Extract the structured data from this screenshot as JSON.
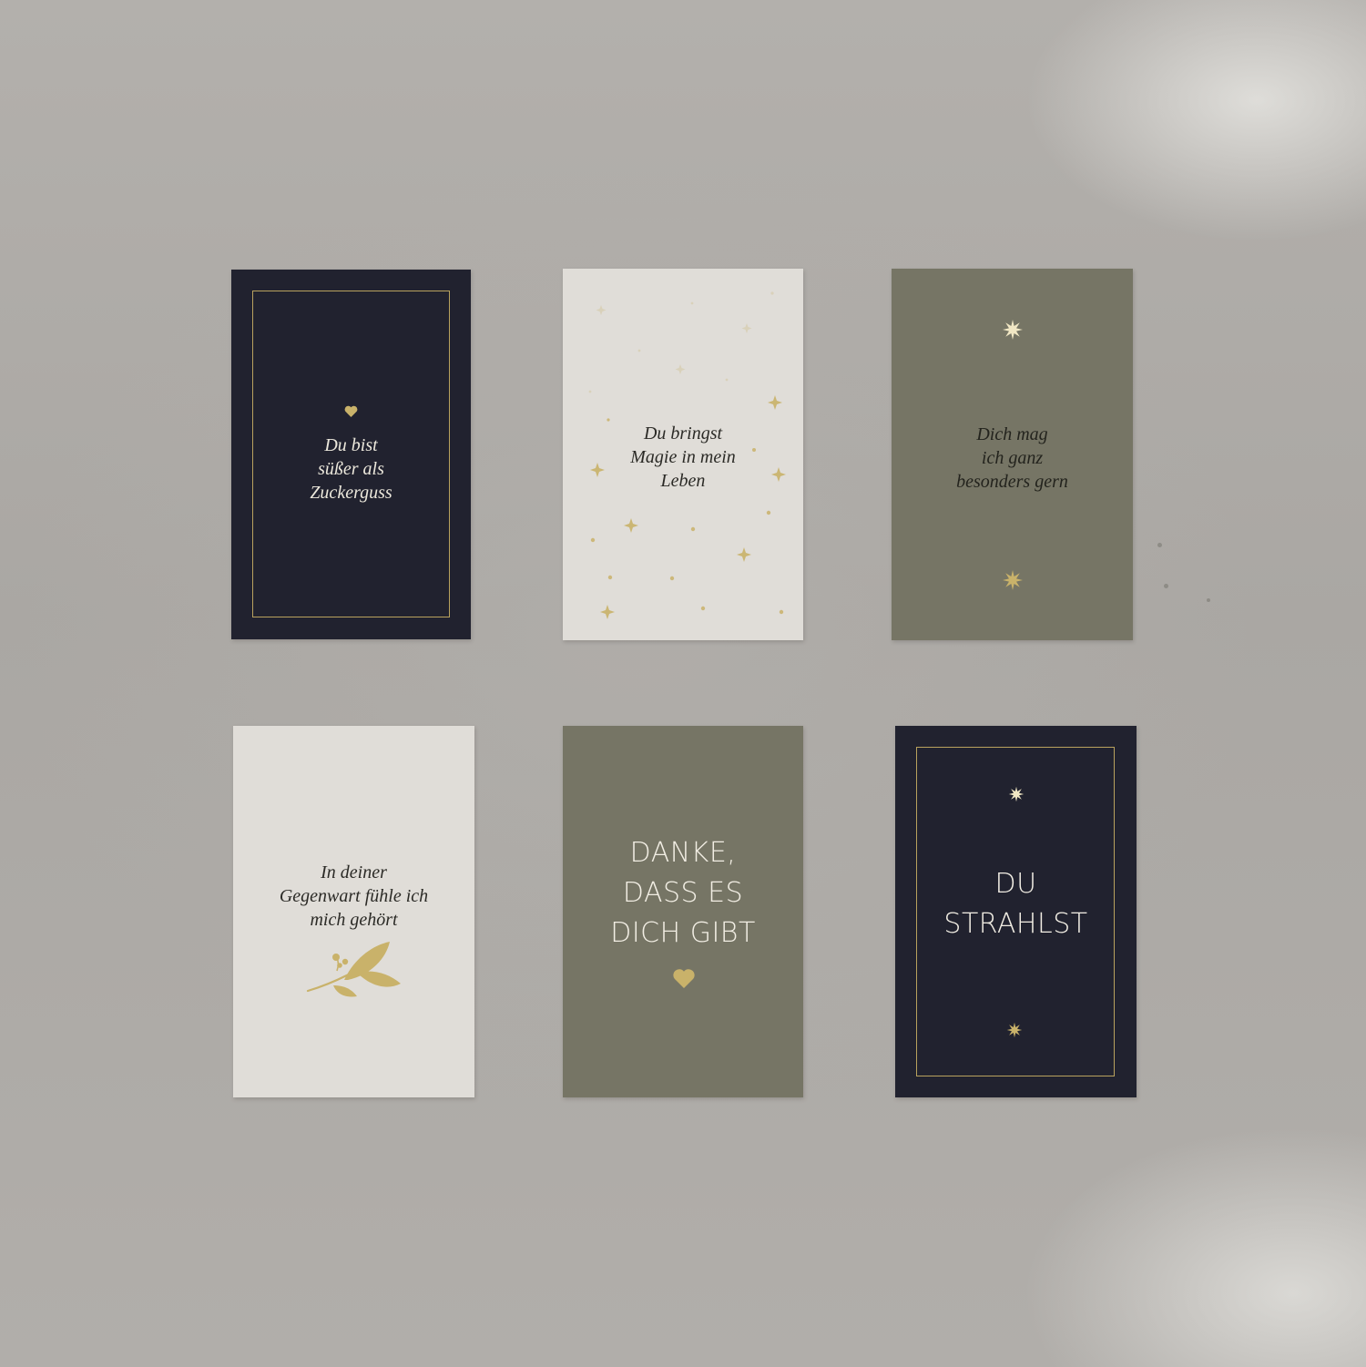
{
  "cards": [
    {
      "lines": [
        "Du bist",
        "süßer als",
        "Zuckerguss"
      ],
      "ornament": "heart-icon",
      "background": "#21222f",
      "text_color": "#ece8dc"
    },
    {
      "lines": [
        "Du bringst",
        "Magie in mein",
        "Leben"
      ],
      "ornament": "stars-pattern",
      "background": "#e0ddd8",
      "text_color": "#2b2a26"
    },
    {
      "lines": [
        "Dich mag",
        "ich ganz",
        "besonders gern"
      ],
      "ornament": "sunburst-icon",
      "background": "#767565",
      "text_color": "#23231d"
    },
    {
      "lines": [
        "In deiner",
        "Gegenwart fühle ich",
        "mich gehört"
      ],
      "ornament": "leaf-branch-icon",
      "background": "#e0ddd8",
      "text_color": "#2b2a26"
    },
    {
      "lines": [
        "DANKE,",
        "DASS ES",
        "DICH GIBT"
      ],
      "ornament": "heart-icon",
      "background": "#767565",
      "text_color": "#f2eee4"
    },
    {
      "lines": [
        "DU",
        "STRAHLST"
      ],
      "ornament": "sunburst-icon",
      "background": "#21222f",
      "text_color": "#f2eee4"
    }
  ],
  "colors": {
    "gold_foil": "#c9b26a",
    "wall": "#aeaba7"
  }
}
